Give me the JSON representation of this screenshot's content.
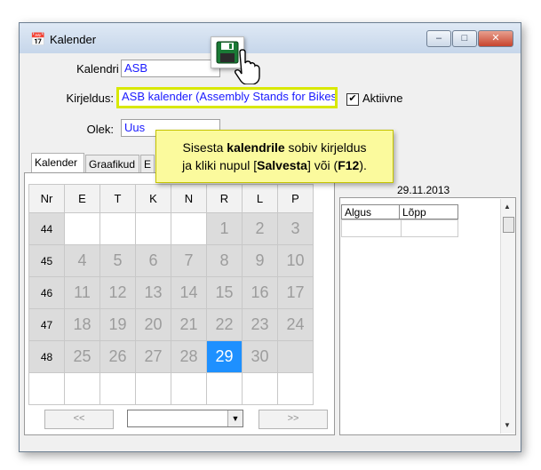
{
  "window": {
    "title": "Kalender",
    "controls": {
      "minimize": "–",
      "maximize": "□",
      "close": "✕"
    }
  },
  "form": {
    "id_label": "Kalendri ID:",
    "id_value": "ASB",
    "desc_label": "Kirjeldus:",
    "desc_value": "ASB kalender (Assembly Stands for Bikes)",
    "active_label": "Aktiivne",
    "active_checked": true,
    "active_mark": "✔",
    "state_label": "Olek:",
    "state_value": "Uus"
  },
  "tabs": [
    "Kalender",
    "Graafikud",
    "E"
  ],
  "calendar": {
    "headers": [
      "Nr",
      "E",
      "T",
      "K",
      "N",
      "R",
      "L",
      "P"
    ],
    "weeks": [
      {
        "nr": "44",
        "days": [
          "",
          "",
          "",
          "",
          "1",
          "2",
          "3"
        ]
      },
      {
        "nr": "45",
        "days": [
          "4",
          "5",
          "6",
          "7",
          "8",
          "9",
          "10"
        ]
      },
      {
        "nr": "46",
        "days": [
          "11",
          "12",
          "13",
          "14",
          "15",
          "16",
          "17"
        ]
      },
      {
        "nr": "47",
        "days": [
          "18",
          "19",
          "20",
          "21",
          "22",
          "23",
          "24"
        ]
      },
      {
        "nr": "48",
        "days": [
          "25",
          "26",
          "27",
          "28",
          "29",
          "30",
          ""
        ]
      }
    ],
    "selected_day": "29",
    "prev_label": "<<",
    "next_label": ">>",
    "month_select_value": ""
  },
  "schedule": {
    "date": "29.11.2013",
    "columns": [
      "Algus",
      "Lõpp"
    ]
  },
  "tooltip": {
    "part1": "Sisesta ",
    "bold1": "kalendrile",
    "part2": " sobiv kirjeldus",
    "part3": "ja kliki nupul [",
    "bold2": "Salvesta",
    "part4": "] või (",
    "bold3": "F12",
    "part5": ")."
  },
  "icons": {
    "window_icon": "calendar-icon",
    "save": "floppy-disk-icon",
    "cursor": "hand-pointer-icon"
  },
  "colors": {
    "selected_day": "#1e90ff",
    "highlight_border": "#d8e800",
    "tooltip_bg": "#fbfa9d",
    "field_text": "#1a1aff"
  }
}
